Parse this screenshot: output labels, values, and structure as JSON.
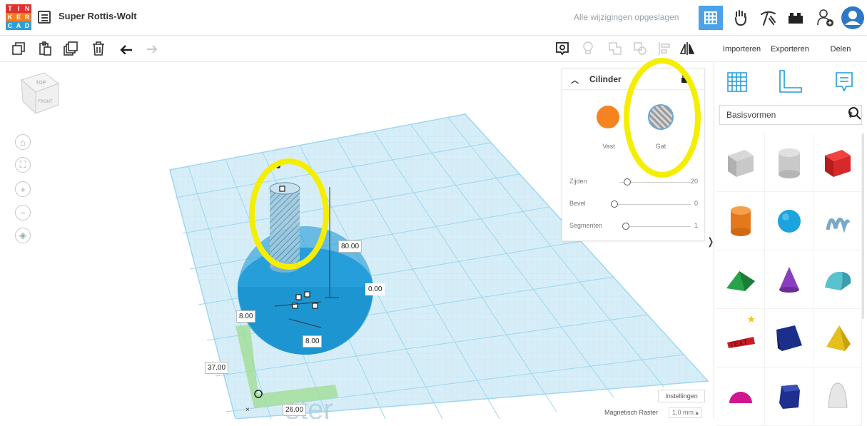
{
  "app": {
    "logo_letters": [
      "T",
      "I",
      "N",
      "K",
      "E",
      "R",
      "C",
      "A",
      "D"
    ],
    "project_title": "Super Rottis-Wolt",
    "save_status": "Alle wijzigingen opgeslagen"
  },
  "toolbar": {
    "import_label": "Importeren",
    "export_label": "Exporteren",
    "share_label": "Delen"
  },
  "view_cube": {
    "top": "TOP",
    "front": "FRONT"
  },
  "inspector": {
    "shape_name": "Cilinder",
    "solid_label": "Vast",
    "hole_label": "Gat",
    "params": [
      {
        "label": "Zijden",
        "value": "20"
      },
      {
        "label": "Bevel",
        "value": "0"
      },
      {
        "label": "Segmenten",
        "value": "1"
      }
    ]
  },
  "library": {
    "category": "Basisvormen"
  },
  "canvas": {
    "dim_height": "80.00",
    "dim_elev": "0.00",
    "dim_width": "8.00",
    "dim_depth": "8.00",
    "dim_x": "37.00",
    "dim_y": "26.00",
    "watermark": "ster"
  },
  "footer": {
    "settings_label": "Instellingen",
    "snap_label": "Magnetisch Raster",
    "snap_value": "1,0 mm"
  },
  "colors": {
    "accent": "#4aa3e8",
    "highlight": "#f5ee00",
    "grid": "#9fd6ee",
    "shape_blue": "#1e9bd7"
  }
}
